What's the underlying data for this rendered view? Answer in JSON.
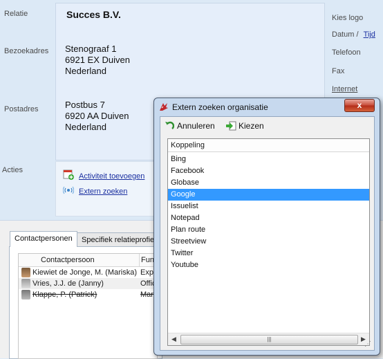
{
  "labels": {
    "relatie": "Relatie",
    "bezoekadres": "Bezoekadres",
    "postadres": "Postadres",
    "acties": "Acties"
  },
  "company": {
    "name": "Succes B.V.",
    "visit_line1": "Stenograaf 1",
    "visit_line2": "6921 EX  Duiven",
    "visit_line3": "Nederland",
    "post_line1": "Postbus 7",
    "post_line2": "6920 AA  Duiven",
    "post_line3": "Nederland"
  },
  "actions": {
    "activity": "Activiteit toevoegen",
    "external": "Extern zoeken"
  },
  "right_column": {
    "kies_logo": "Kies logo",
    "datum": "Datum /",
    "tijd": "Tijd",
    "telefoon": "Telefoon",
    "fax": "Fax",
    "internet": "Internet"
  },
  "tabs": [
    {
      "label": "Contactpersonen"
    },
    {
      "label": "Specifiek relatieprofiel"
    }
  ],
  "contacts": {
    "col1": "Contactpersoon",
    "col2": "Func",
    "rows": [
      {
        "name": "Kiewiet de Jonge, M. (Mariska)",
        "func": "Expo"
      },
      {
        "name": "Vries, J.J. de (Janny)",
        "func": "Offic"
      },
      {
        "name": "Klappe, P. (Patrick)",
        "func": "Mana"
      }
    ]
  },
  "dialog": {
    "title": "Extern zoeken organisatie",
    "close": "x",
    "annuleren": "Annuleren",
    "kiezen": "Kiezen",
    "column": "Koppeling",
    "items": [
      "Bing",
      "Facebook",
      "Globase",
      "Google",
      "Issuelist",
      "Notepad",
      "Plan route",
      "Streetview",
      "Twitter",
      "Youtube"
    ],
    "selected": "Google"
  },
  "colors": {
    "background": "#dce9f6",
    "link": "#1a2fa0",
    "selection": "#3399ff"
  }
}
